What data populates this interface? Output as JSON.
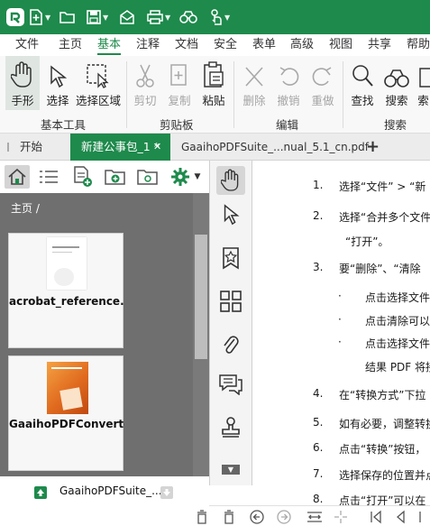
{
  "titlebar": {
    "icons": [
      "app-logo-icon",
      "new-document-icon",
      "open-folder-icon",
      "save-icon",
      "email-icon",
      "print-icon",
      "binoculars-icon",
      "touch-mode-icon"
    ]
  },
  "menu": {
    "tabs": [
      "文件",
      "主页",
      "基本",
      "注释",
      "文档",
      "安全",
      "表单",
      "高级",
      "视图",
      "共享",
      "帮助"
    ],
    "active": "基本"
  },
  "ribbon": {
    "buttons": {
      "hand": "手形",
      "select": "选择",
      "select_area": "选择区域",
      "cut": "剪切",
      "copy": "复制",
      "paste": "粘贴",
      "delete": "删除",
      "undo": "撤销",
      "redo": "重做",
      "find": "查找",
      "search": "搜索",
      "index": "索"
    },
    "groups": {
      "basic_tools": "基本工具",
      "clipboard": "剪贴板",
      "edit": "编辑",
      "search": "搜索"
    }
  },
  "tabs": {
    "start": "开始",
    "active_doc": "新建公事包_1 *",
    "close": "✕",
    "other_doc": "GaaihoPDFSuite_...nual_5.1_cn.pdf",
    "add": "+"
  },
  "leftpanel": {
    "breadcrumb": "主页 /",
    "files": [
      {
        "name": "acrobat_reference.pdf"
      },
      {
        "name": "GaaihoPDFConverter..."
      }
    ],
    "bottom_file": "GaaihoPDFSuite_..."
  },
  "document": {
    "steps": [
      {
        "num": "1.",
        "text": "选择“文件” > “新"
      },
      {
        "num": "2.",
        "text": "选择“合并多个文件"
      },
      {
        "num": "",
        "text": "“打开”。"
      },
      {
        "num": "3.",
        "text": "要“删除”、“清除"
      },
      {
        "num": "·",
        "text": "点击选择文件"
      },
      {
        "num": "·",
        "text": "点击清除可以"
      },
      {
        "num": "·",
        "text": "点击选择文件"
      },
      {
        "num": "",
        "text": "结果 PDF 将接"
      },
      {
        "num": "4.",
        "text": "在“转换方式”下拉"
      },
      {
        "num": "5.",
        "text": "如有必要，调整转换"
      },
      {
        "num": "6.",
        "text": "点击“转换”按钮，"
      },
      {
        "num": "7.",
        "text": "选择保存的位置并点"
      },
      {
        "num": "8.",
        "text": "点击“打开”可以在"
      }
    ]
  },
  "colors": {
    "brand_green": "#1e8a4c",
    "panel_gray": "#6f6f6f"
  }
}
